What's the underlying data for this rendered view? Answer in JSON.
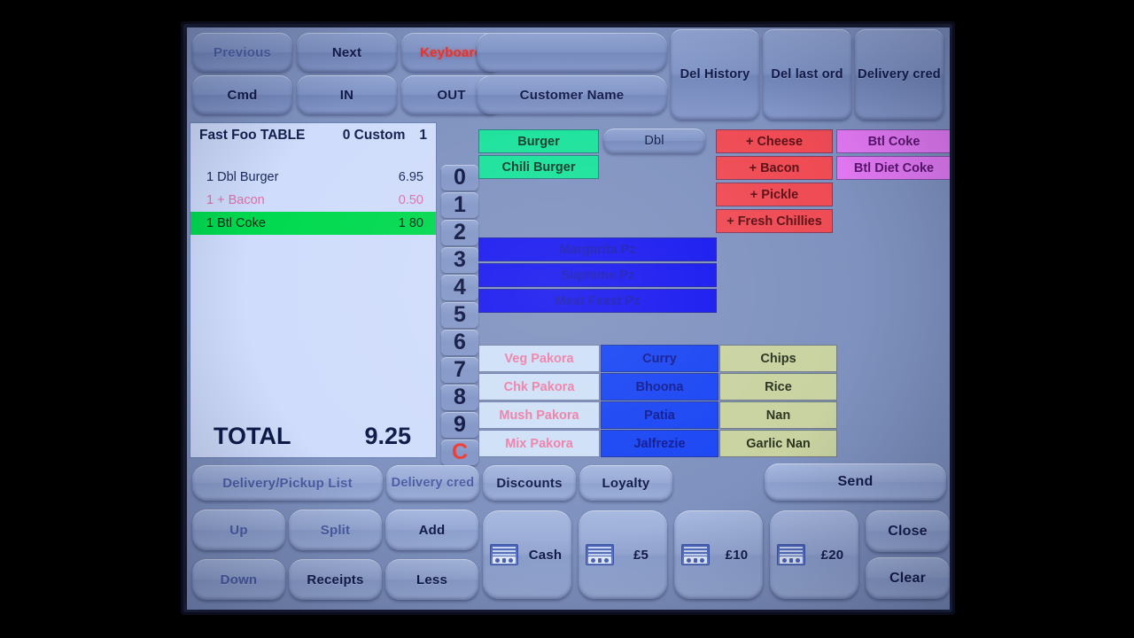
{
  "screen": {
    "accent_blue": "#1818f0",
    "selected_row_color": "#00d94f",
    "button_face": "#8195c6"
  },
  "toolbar": {
    "row1": [
      {
        "label": "Previous",
        "style": "dim"
      },
      {
        "label": "Next",
        "style": "normal"
      },
      {
        "label": "Keyboard",
        "style": "red"
      },
      {
        "label": "",
        "style": "normal"
      }
    ],
    "row2": [
      {
        "label": "Cmd",
        "style": "normal"
      },
      {
        "label": "IN",
        "style": "normal"
      },
      {
        "label": "OUT",
        "style": "normal"
      },
      {
        "label": "Customer Name",
        "style": "normal"
      }
    ],
    "tall": [
      {
        "label": "Del History"
      },
      {
        "label": "Del last ord"
      },
      {
        "label": "Delivery cred"
      }
    ]
  },
  "order": {
    "header": {
      "title": "Fast Foo TABLE",
      "table": "0 Custom",
      "covers": "1"
    },
    "lines": [
      {
        "qty_name": "1 Dbl Burger",
        "price": "6.95",
        "style": "plain"
      },
      {
        "qty_name": "1 + Bacon",
        "price": "0.50",
        "style": "mod"
      },
      {
        "qty_name": "1 Btl Coke",
        "price": "1 80",
        "style": "sel"
      }
    ],
    "total_label": "TOTAL",
    "total_value": "9.25"
  },
  "keypad": [
    "0",
    "1",
    "2",
    "3",
    "4",
    "5",
    "6",
    "7",
    "8",
    "9",
    "C"
  ],
  "products": {
    "burgers": [
      {
        "label": "Burger"
      },
      {
        "label": "Chili Burger"
      }
    ],
    "dbl": {
      "label": "Dbl"
    },
    "modifiers": [
      {
        "label": "+ Cheese"
      },
      {
        "label": "+ Bacon"
      },
      {
        "label": "+ Pickle"
      },
      {
        "label": "+ Fresh Chillies"
      }
    ],
    "drinks": [
      {
        "label": "Btl Coke"
      },
      {
        "label": "Btl Diet Coke"
      }
    ],
    "pizzas": [
      {
        "label": "Margarita Pz"
      },
      {
        "label": "Supreme Pz"
      },
      {
        "label": "Meat Feast Pz"
      }
    ],
    "pakora": [
      {
        "label": "Veg Pakora"
      },
      {
        "label": "Chk Pakora"
      },
      {
        "label": "Mush Pakora"
      },
      {
        "label": "Mix Pakora"
      }
    ],
    "curry": [
      {
        "label": "Curry"
      },
      {
        "label": "Bhoona"
      },
      {
        "label": "Patia"
      },
      {
        "label": "Jalfrezie"
      }
    ],
    "sides": [
      {
        "label": "Chips"
      },
      {
        "label": "Rice"
      },
      {
        "label": "Nan"
      },
      {
        "label": "Garlic Nan"
      }
    ]
  },
  "footer": {
    "row1": [
      {
        "label": "Delivery/Pickup List",
        "style": "dim"
      },
      {
        "label": "Delivery cred",
        "style": "dim"
      },
      {
        "label": "Discounts",
        "style": "normal"
      },
      {
        "label": "Loyalty",
        "style": "normal"
      }
    ],
    "nav": [
      {
        "label": "Up",
        "style": "dim"
      },
      {
        "label": "Split",
        "style": "dim"
      },
      {
        "label": "Add",
        "style": "normal"
      },
      {
        "label": "Down",
        "style": "dim"
      },
      {
        "label": "Receipts",
        "style": "normal"
      },
      {
        "label": "Less",
        "style": "normal"
      }
    ],
    "cash": [
      {
        "label": "Cash",
        "icon": "banknote-icon"
      },
      {
        "label": "£5",
        "icon": "banknote-icon"
      },
      {
        "label": "£10",
        "icon": "banknote-icon"
      },
      {
        "label": "£20",
        "icon": "banknote-icon"
      }
    ],
    "send": {
      "label": "Send"
    },
    "close": {
      "label": "Close"
    },
    "clear": {
      "label": "Clear"
    }
  }
}
